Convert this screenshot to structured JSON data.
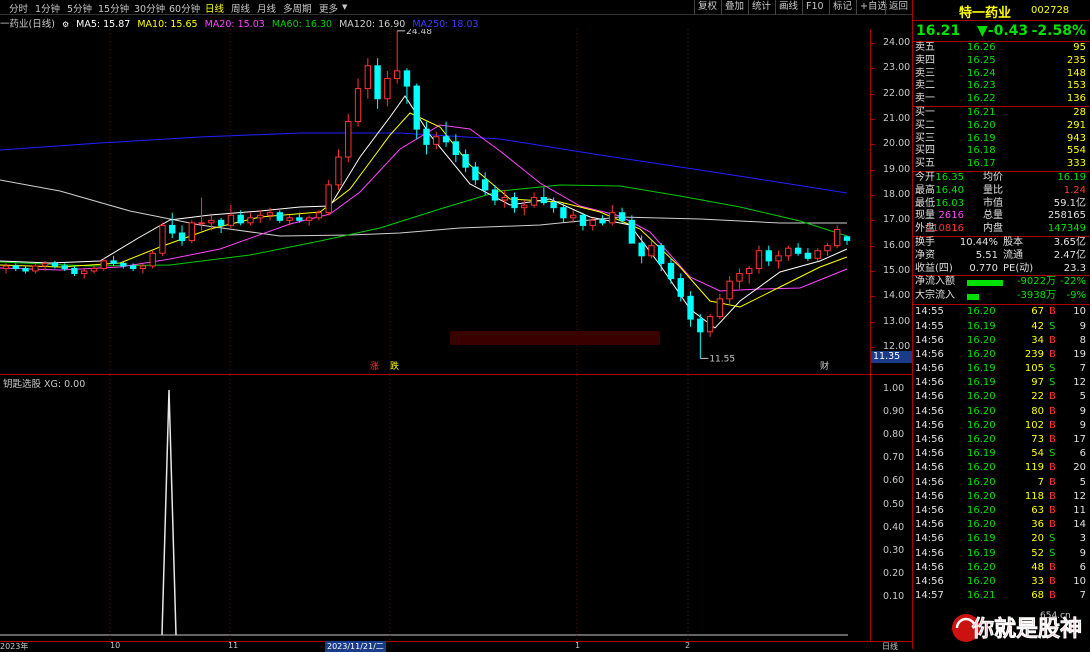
{
  "period_tabs": [
    "分时",
    "1分钟",
    "5分钟",
    "15分钟",
    "30分钟",
    "60分钟",
    "日线",
    "周线",
    "月线",
    "多周期",
    "更多"
  ],
  "selected_period": "日线",
  "top_buttons": [
    "复权",
    "叠加",
    "统计",
    "画线",
    "F10",
    "标记",
    "+自选",
    "返回"
  ],
  "ma_line": {
    "title": "一药业(日线)",
    "ma5": "MA5: 15.87",
    "ma10": "MA10: 15.65",
    "ma20": "MA20: 15.03",
    "ma60": "MA60: 16.30",
    "ma120": "MA120: 16.90",
    "ma250": "MA250: 18.03"
  },
  "colors": {
    "up": "#ff3333",
    "down": "#00ffff",
    "ma5": "#ffffff",
    "ma10": "#ffff00",
    "ma20": "#ff44ff",
    "ma60": "#00cc00",
    "ma120": "#cfcfcf",
    "ma250": "#2020ff"
  },
  "price_axis": [
    "24.00",
    "23.00",
    "22.00",
    "21.00",
    "20.00",
    "19.00",
    "18.00",
    "17.00",
    "16.00",
    "15.00",
    "14.00",
    "13.00",
    "12.00"
  ],
  "annotations": {
    "high": "24.48",
    "low": "11.55",
    "last": "11.35",
    "tag_zhang": "涨",
    "tag_die": "跌",
    "tag_cai": "财"
  },
  "indicator": {
    "label": "钥匙选股 XG: 0.00",
    "axis": [
      "1.00",
      "0.90",
      "0.80",
      "0.70",
      "0.60",
      "0.50",
      "0.40",
      "0.30",
      "0.20",
      "0.10"
    ]
  },
  "date_axis": {
    "d1": "2023年",
    "d2": "10",
    "d3": "11",
    "d4": "2023/11/21/二",
    "d5": "1",
    "d6": "2",
    "d7": "日线"
  },
  "stock": {
    "name": "特一药业",
    "code": "002728",
    "price": "16.21",
    "change": "▼-0.43",
    "pct": "-2.58%"
  },
  "asks": [
    {
      "label": "卖五",
      "price": "16.26",
      "vol": "95"
    },
    {
      "label": "卖四",
      "price": "16.25",
      "vol": "235"
    },
    {
      "label": "卖三",
      "price": "16.24",
      "vol": "148"
    },
    {
      "label": "卖二",
      "price": "16.23",
      "vol": "153"
    },
    {
      "label": "卖一",
      "price": "16.22",
      "vol": "136"
    }
  ],
  "bids": [
    {
      "label": "买一",
      "price": "16.21",
      "vol": "28"
    },
    {
      "label": "买二",
      "price": "16.20",
      "vol": "291"
    },
    {
      "label": "买三",
      "price": "16.19",
      "vol": "943"
    },
    {
      "label": "买四",
      "price": "16.18",
      "vol": "554"
    },
    {
      "label": "买五",
      "price": "16.17",
      "vol": "333"
    }
  ],
  "stats": [
    {
      "l1": "今开",
      "v1": "16.35",
      "l2": "均价",
      "v2": "16.19"
    },
    {
      "l1": "最高",
      "v1": "16.40",
      "l2": "量比",
      "v2": "1.24"
    },
    {
      "l1": "最低",
      "v1": "16.03",
      "l2": "市值",
      "v2": "59.1亿"
    },
    {
      "l1": "现量",
      "v1": "2616",
      "l2": "总量",
      "v2": "258165"
    },
    {
      "l1": "外盘",
      "v1": "110816",
      "l2": "内盘",
      "v2": "147349"
    }
  ],
  "stats2": [
    {
      "l1": "换手",
      "v1": "10.44%",
      "l2": "股本",
      "v2": "3.65亿"
    },
    {
      "l1": "净资",
      "v1": "5.51",
      "l2": "流通",
      "v2": "2.47亿"
    },
    {
      "l1": "收益(四)",
      "v1": "0.770",
      "l2": "PE(动)",
      "v2": "23.3"
    }
  ],
  "flows": [
    {
      "label": "净流入额",
      "val": "-9022万",
      "pct": "-22%",
      "bar": 0.9
    },
    {
      "label": "大宗流入",
      "val": "-3938万",
      "pct": "-9%",
      "bar": 0.3
    }
  ],
  "ticks": [
    {
      "t": "14:55",
      "p": "16.20",
      "v": "67",
      "s": "B",
      "n": "10"
    },
    {
      "t": "14:55",
      "p": "16.19",
      "v": "42",
      "s": "S",
      "n": "9"
    },
    {
      "t": "14:56",
      "p": "16.20",
      "v": "34",
      "s": "B",
      "n": "8"
    },
    {
      "t": "14:56",
      "p": "16.20",
      "v": "239",
      "s": "B",
      "n": "19"
    },
    {
      "t": "14:56",
      "p": "16.19",
      "v": "105",
      "s": "S",
      "n": "7"
    },
    {
      "t": "14:56",
      "p": "16.19",
      "v": "97",
      "s": "S",
      "n": "12"
    },
    {
      "t": "14:56",
      "p": "16.20",
      "v": "22",
      "s": "B",
      "n": "5"
    },
    {
      "t": "14:56",
      "p": "16.20",
      "v": "80",
      "s": "B",
      "n": "9"
    },
    {
      "t": "14:56",
      "p": "16.20",
      "v": "102",
      "s": "B",
      "n": "9"
    },
    {
      "t": "14:56",
      "p": "16.20",
      "v": "73",
      "s": "B",
      "n": "17"
    },
    {
      "t": "14:56",
      "p": "16.19",
      "v": "54",
      "s": "S",
      "n": "6"
    },
    {
      "t": "14:56",
      "p": "16.20",
      "v": "119",
      "s": "B",
      "n": "20"
    },
    {
      "t": "14:56",
      "p": "16.20",
      "v": "7",
      "s": "B",
      "n": "5"
    },
    {
      "t": "14:56",
      "p": "16.20",
      "v": "118",
      "s": "B",
      "n": "12"
    },
    {
      "t": "14:56",
      "p": "16.20",
      "v": "63",
      "s": "B",
      "n": "11"
    },
    {
      "t": "14:56",
      "p": "16.20",
      "v": "36",
      "s": "B",
      "n": "14"
    },
    {
      "t": "14:56",
      "p": "16.19",
      "v": "20",
      "s": "S",
      "n": "3"
    },
    {
      "t": "14:56",
      "p": "16.19",
      "v": "52",
      "s": "S",
      "n": "9"
    },
    {
      "t": "14:56",
      "p": "16.20",
      "v": "48",
      "s": "B",
      "n": "6"
    },
    {
      "t": "14:56",
      "p": "16.20",
      "v": "33",
      "s": "B",
      "n": "10"
    },
    {
      "t": "14:57",
      "p": "16.21",
      "v": "68",
      "s": "B",
      "n": "7"
    }
  ],
  "watermark": {
    "text": "你就是股神",
    "sub": "654.cn"
  },
  "candles": [
    [
      15.1,
      15.3,
      14.9,
      15.2
    ],
    [
      15.2,
      15.3,
      15.0,
      15.1
    ],
    [
      15.1,
      15.2,
      14.9,
      15.0
    ],
    [
      15.0,
      15.3,
      14.9,
      15.2
    ],
    [
      15.2,
      15.4,
      15.0,
      15.3
    ],
    [
      15.3,
      15.4,
      15.1,
      15.2
    ],
    [
      15.2,
      15.3,
      15.0,
      15.1
    ],
    [
      15.1,
      15.2,
      14.8,
      14.9
    ],
    [
      14.9,
      15.1,
      14.7,
      15.0
    ],
    [
      15.0,
      15.2,
      14.9,
      15.1
    ],
    [
      15.1,
      15.5,
      15.0,
      15.4
    ],
    [
      15.4,
      15.6,
      15.2,
      15.3
    ],
    [
      15.3,
      15.4,
      15.1,
      15.2
    ],
    [
      15.2,
      15.3,
      15.0,
      15.1
    ],
    [
      15.1,
      15.3,
      14.9,
      15.2
    ],
    [
      15.2,
      15.8,
      15.1,
      15.7
    ],
    [
      15.7,
      16.9,
      15.6,
      16.8
    ],
    [
      16.8,
      17.3,
      16.3,
      16.5
    ],
    [
      16.5,
      16.8,
      16.0,
      16.2
    ],
    [
      16.2,
      17.0,
      16.1,
      16.9
    ],
    [
      16.9,
      17.9,
      16.6,
      16.9
    ],
    [
      16.9,
      17.2,
      16.6,
      17.0
    ],
    [
      17.0,
      17.1,
      16.5,
      16.8
    ],
    [
      16.8,
      17.6,
      16.7,
      17.2
    ],
    [
      17.2,
      17.4,
      16.8,
      16.9
    ],
    [
      16.9,
      17.3,
      16.8,
      17.1
    ],
    [
      17.1,
      17.4,
      16.9,
      17.2
    ],
    [
      17.2,
      17.5,
      17.0,
      17.3
    ],
    [
      17.3,
      17.4,
      16.9,
      17.0
    ],
    [
      17.0,
      17.2,
      16.8,
      17.1
    ],
    [
      17.1,
      17.3,
      16.9,
      17.0
    ],
    [
      17.0,
      17.2,
      16.8,
      17.1
    ],
    [
      17.1,
      17.4,
      17.0,
      17.3
    ],
    [
      17.3,
      18.6,
      17.2,
      18.4
    ],
    [
      18.4,
      19.8,
      18.2,
      19.5
    ],
    [
      19.5,
      21.2,
      19.3,
      20.9
    ],
    [
      20.9,
      22.6,
      20.7,
      22.2
    ],
    [
      22.2,
      23.4,
      21.8,
      23.1
    ],
    [
      23.1,
      23.4,
      21.4,
      21.8
    ],
    [
      21.8,
      22.9,
      21.5,
      22.6
    ],
    [
      22.6,
      24.48,
      22.4,
      22.9
    ],
    [
      22.9,
      23.0,
      21.6,
      22.3
    ],
    [
      22.3,
      22.4,
      20.2,
      20.6
    ],
    [
      20.6,
      20.9,
      19.6,
      20.0
    ],
    [
      20.0,
      20.5,
      19.8,
      20.3
    ],
    [
      20.3,
      20.9,
      19.9,
      20.1
    ],
    [
      20.1,
      20.4,
      19.3,
      19.6
    ],
    [
      19.6,
      19.8,
      18.9,
      19.1
    ],
    [
      19.1,
      19.3,
      18.4,
      18.6
    ],
    [
      18.6,
      18.9,
      18.0,
      18.2
    ],
    [
      18.2,
      18.4,
      17.6,
      17.8
    ],
    [
      17.8,
      18.2,
      17.5,
      17.9
    ],
    [
      17.9,
      18.1,
      17.3,
      17.5
    ],
    [
      17.5,
      17.8,
      17.2,
      17.6
    ],
    [
      17.6,
      18.1,
      17.5,
      17.9
    ],
    [
      17.9,
      18.3,
      17.6,
      17.7
    ],
    [
      17.7,
      17.9,
      17.3,
      17.5
    ],
    [
      17.5,
      17.7,
      16.9,
      17.1
    ],
    [
      17.1,
      17.4,
      16.9,
      17.2
    ],
    [
      17.2,
      17.3,
      16.6,
      16.8
    ],
    [
      16.8,
      17.1,
      16.6,
      17.0
    ],
    [
      17.0,
      17.2,
      16.8,
      16.9
    ],
    [
      16.9,
      17.6,
      16.8,
      17.3
    ],
    [
      17.3,
      17.5,
      16.9,
      17.0
    ],
    [
      17.0,
      17.2,
      16.6,
      16.1
    ],
    [
      16.1,
      16.4,
      15.3,
      15.6
    ],
    [
      15.6,
      16.2,
      15.5,
      16.0
    ],
    [
      16.0,
      16.1,
      15.0,
      15.3
    ],
    [
      15.3,
      15.5,
      14.5,
      14.7
    ],
    [
      14.7,
      14.9,
      13.8,
      14.0
    ],
    [
      14.0,
      14.2,
      12.8,
      13.1
    ],
    [
      13.1,
      13.3,
      11.55,
      12.6
    ],
    [
      12.6,
      13.3,
      12.4,
      13.2
    ],
    [
      13.2,
      14.1,
      13.1,
      13.9
    ],
    [
      13.9,
      14.8,
      13.7,
      14.6
    ],
    [
      14.6,
      15.1,
      14.3,
      14.9
    ],
    [
      14.9,
      15.2,
      14.5,
      15.1
    ],
    [
      15.1,
      16.0,
      14.9,
      15.8
    ],
    [
      15.8,
      16.0,
      15.2,
      15.4
    ],
    [
      15.4,
      15.8,
      15.1,
      15.6
    ],
    [
      15.6,
      16.0,
      15.4,
      15.9
    ],
    [
      15.9,
      16.1,
      15.6,
      15.7
    ],
    [
      15.7,
      15.9,
      15.4,
      15.5
    ],
    [
      15.5,
      15.9,
      15.4,
      15.8
    ],
    [
      15.8,
      16.1,
      15.6,
      16.0
    ],
    [
      16.0,
      16.8,
      15.9,
      16.64
    ],
    [
      16.35,
      16.4,
      16.03,
      16.21
    ]
  ]
}
